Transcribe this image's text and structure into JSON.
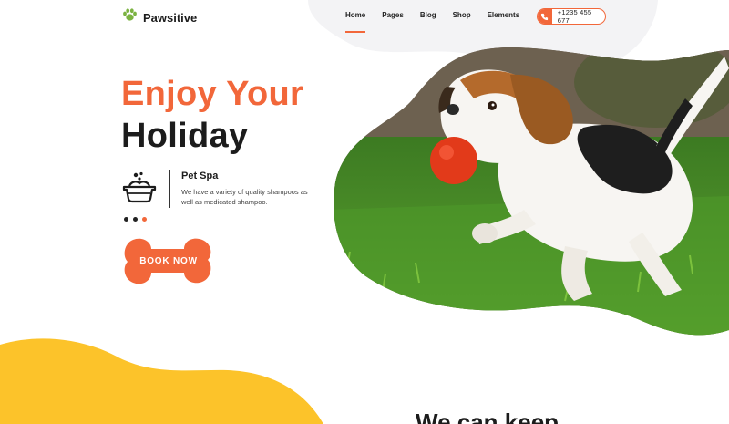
{
  "brand": {
    "name": "Pawsitive"
  },
  "nav": {
    "items": [
      {
        "label": "Home",
        "active": true
      },
      {
        "label": "Pages",
        "active": false
      },
      {
        "label": "Blog",
        "active": false
      },
      {
        "label": "Shop",
        "active": false
      },
      {
        "label": "Elements",
        "active": false
      }
    ],
    "phone": "+1235 455 677"
  },
  "hero": {
    "line1": "Enjoy Your",
    "line2": "Holiday",
    "service": {
      "title": "Pet Spa",
      "description": "We have a variety of quality shampoos as well as medicated shampoo."
    },
    "slider_dots": 3,
    "active_dot": 3,
    "cta_label": "BOOK NOW"
  },
  "next_section": {
    "heading": "We can keep"
  },
  "colors": {
    "accent": "#f2673a",
    "dark": "#1c1c1c",
    "yellow": "#fcc32a",
    "blob_gray": "#f3f3f5",
    "logo_green": "#7cb342"
  },
  "icons": {
    "logo": "paw-icon",
    "phone": "phone-icon",
    "service": "pet-bath-icon"
  }
}
